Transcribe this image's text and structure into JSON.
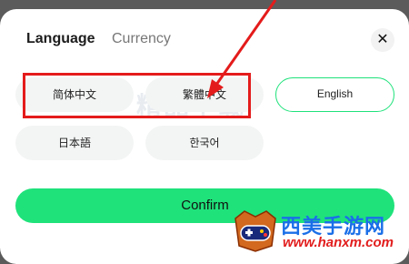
{
  "tabs": {
    "language": "Language",
    "currency": "Currency"
  },
  "close_glyph": "✕",
  "languages": [
    {
      "label": "简体中文",
      "state": "filled"
    },
    {
      "label": "繁體中文",
      "state": "filled"
    },
    {
      "label": "English",
      "state": "selected"
    },
    {
      "label": "日本語",
      "state": "filled"
    },
    {
      "label": "한국어",
      "state": "filled"
    }
  ],
  "confirm_label": "Confirm",
  "watermark": {
    "text": "精品下载",
    "brand": "西美手游网",
    "url": "www.hanxm.com"
  },
  "colors": {
    "accent": "#1fe27b",
    "annotation": "#e41b1b"
  }
}
